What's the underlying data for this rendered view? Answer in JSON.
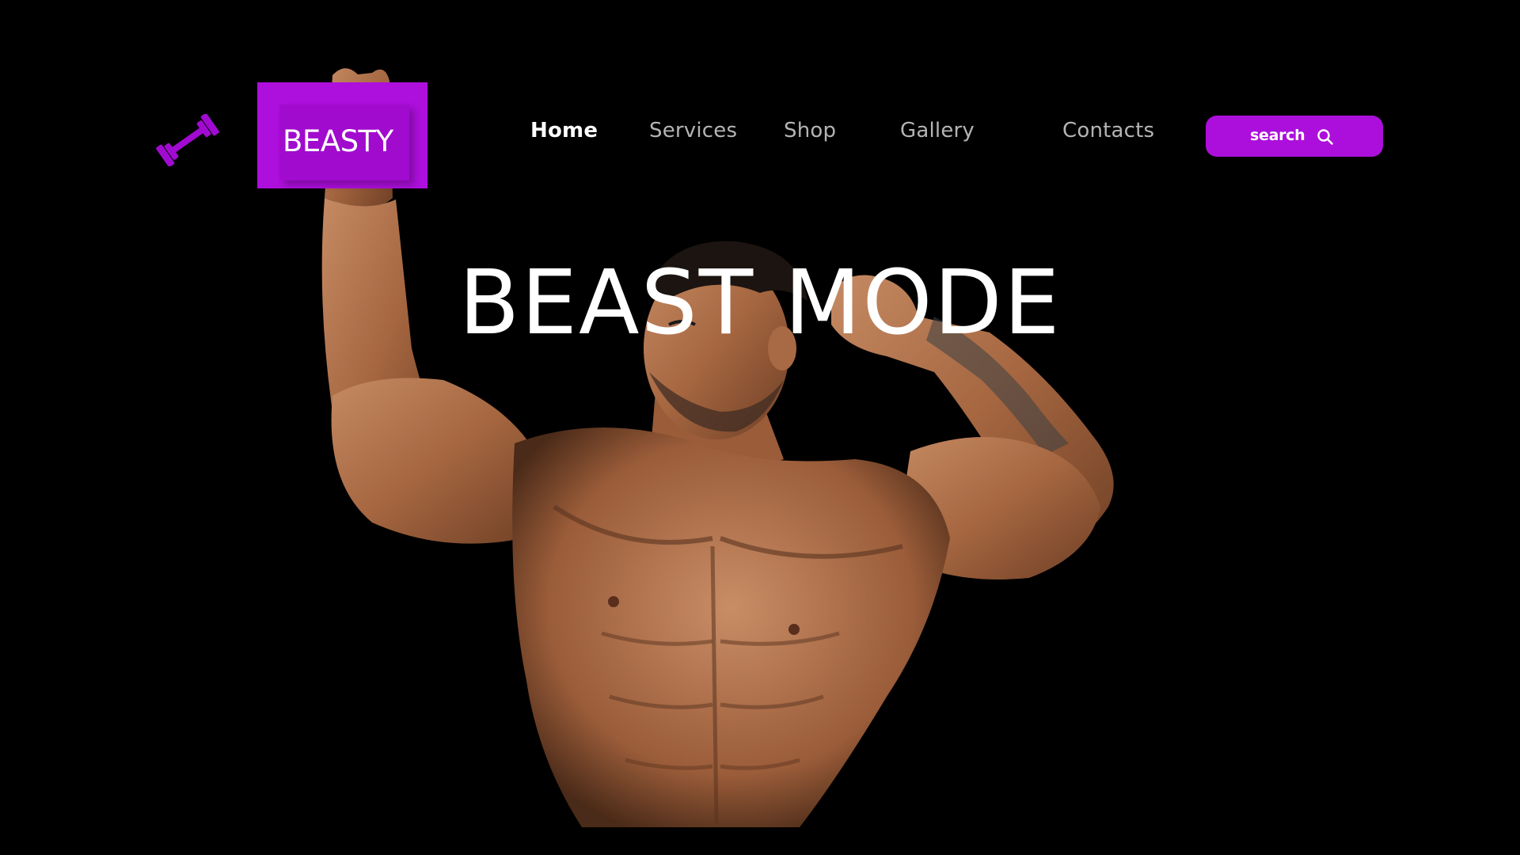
{
  "brand": {
    "name": "BEASTY",
    "logo_icon": "dumbbell-icon",
    "accent_color": "#ad0fdc"
  },
  "nav": {
    "items": [
      {
        "label": "Home",
        "active": true
      },
      {
        "label": "Services",
        "active": false
      },
      {
        "label": "Shop",
        "active": false
      },
      {
        "label": "Gallery",
        "active": false
      },
      {
        "label": "Contacts",
        "active": false
      }
    ]
  },
  "search": {
    "label": "search",
    "icon": "search-icon"
  },
  "hero": {
    "headline": "BEAST MODE",
    "background_color": "#000000"
  }
}
